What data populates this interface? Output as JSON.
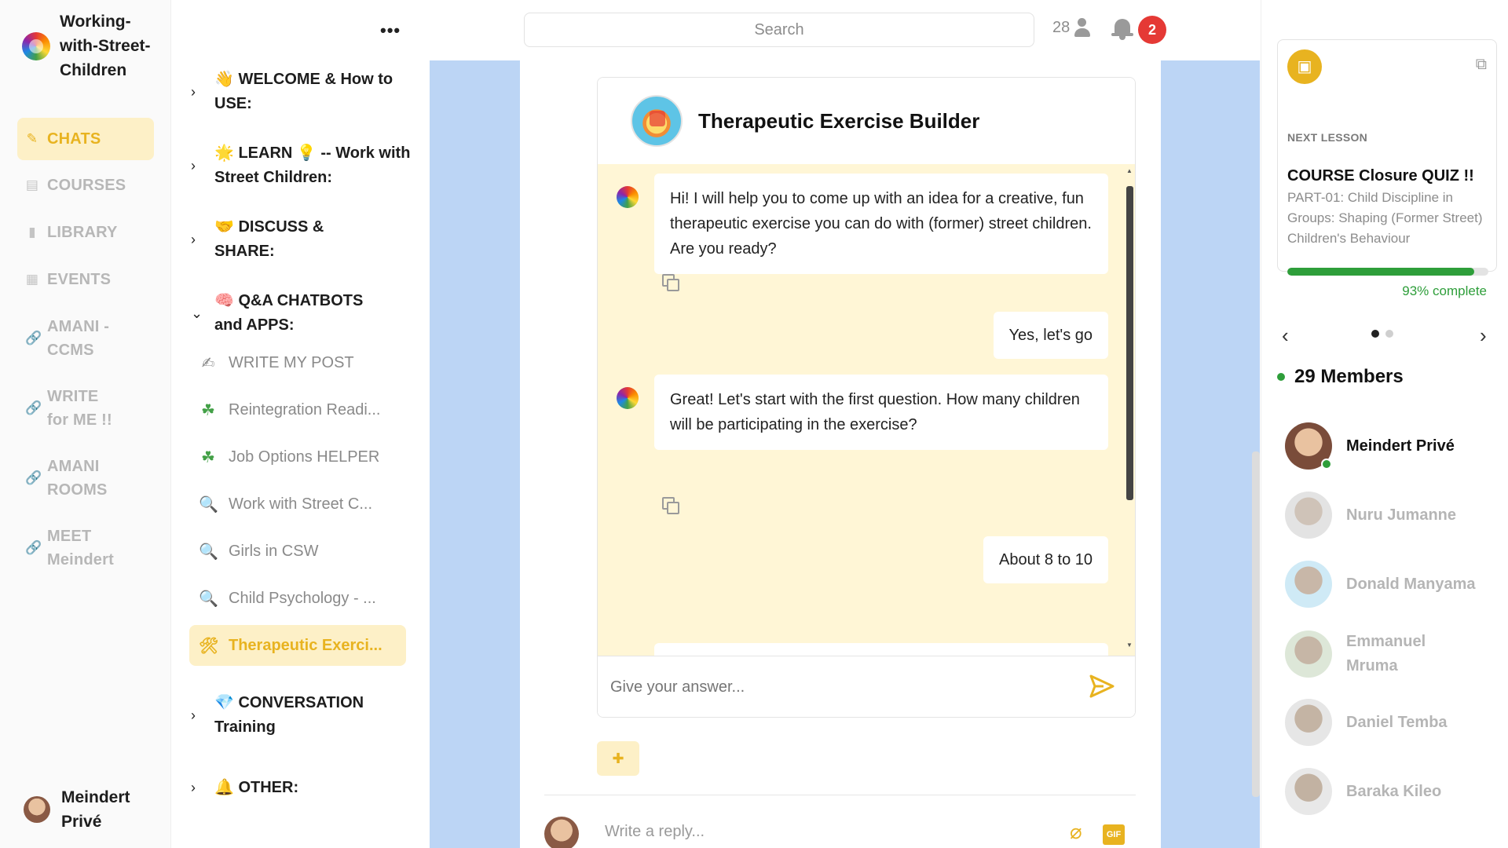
{
  "brand": {
    "name": "Working-with-Street-Children"
  },
  "nav": {
    "items": [
      {
        "label": "CHATS",
        "icon": "pencil-icon",
        "active": true
      },
      {
        "label": "COURSES",
        "icon": "book-icon"
      },
      {
        "label": "LIBRARY",
        "icon": "document-icon"
      },
      {
        "label": "EVENTS",
        "icon": "calendar-icon"
      },
      {
        "label": "AMANI - CCMS",
        "icon": "link-icon"
      },
      {
        "label": "WRITE for ME !!",
        "icon": "link-icon"
      },
      {
        "label": "AMANI ROOMS",
        "icon": "link-icon"
      },
      {
        "label": "MEET Meindert",
        "icon": "link-icon"
      }
    ],
    "user_name": "Meindert Privé"
  },
  "channels": {
    "more_label": "•••",
    "groups": [
      {
        "title": "👋 WELCOME & How to USE:",
        "expanded": false
      },
      {
        "title": "🌟 LEARN 💡 -- Work with Street Children:",
        "expanded": false
      },
      {
        "title": "🤝 DISCUSS & SHARE:",
        "expanded": false
      },
      {
        "title": "🧠 Q&A CHATBOTS and APPS:",
        "expanded": true
      },
      {
        "title": "💎 CONVERSATION Training",
        "expanded": false
      },
      {
        "title": "🔔 OTHER:",
        "expanded": false
      }
    ],
    "items": [
      {
        "label": "WRITE MY POST",
        "icon": "✍"
      },
      {
        "label": "Reintegration Readi...",
        "icon": "☘"
      },
      {
        "label": "Job Options HELPER",
        "icon": "☘"
      },
      {
        "label": "Work with Street C...",
        "icon": "🔍"
      },
      {
        "label": "Girls in CSW",
        "icon": "🔍"
      },
      {
        "label": "Child Psychology - ...",
        "icon": "🔍"
      },
      {
        "label": "Therapeutic Exerci...",
        "icon": "🛠",
        "active": true
      }
    ]
  },
  "topbar": {
    "search_placeholder": "Search",
    "online_count": "28",
    "notification_count": "2"
  },
  "chat": {
    "title": "Therapeutic Exercise Builder",
    "messages": [
      {
        "role": "bot",
        "text": "Hi! I will help you to come up with an idea for a creative, fun therapeutic exercise you can do with (former) street children. Are you ready?"
      },
      {
        "role": "user",
        "text": "Yes, let's go"
      },
      {
        "role": "bot",
        "text": "Great! Let's start with the first question. How many children will be participating in the exercise?"
      },
      {
        "role": "user",
        "text": "About 8 to 10"
      }
    ],
    "answer_placeholder": "Give your answer...",
    "reply_placeholder": "Write a reply...",
    "gif_label": "GIF"
  },
  "lesson": {
    "next_label": "NEXT LESSON",
    "title": "COURSE Closure QUIZ !!",
    "subtitle": "PART-01: Child Discipline in Groups: Shaping (Former Street) Children's Behaviour",
    "progress": 0.93,
    "progress_text": "93% complete"
  },
  "members": {
    "title": "29 Members",
    "list": [
      {
        "name": "Meindert Privé",
        "online": true
      },
      {
        "name": "Nuru Jumanne",
        "online": false
      },
      {
        "name": "Donald Manyama",
        "online": false
      },
      {
        "name": "Emmanuel Mruma",
        "online": false
      },
      {
        "name": "Daniel Temba",
        "online": false
      },
      {
        "name": "Baraka Kileo",
        "online": false
      }
    ]
  },
  "colors": {
    "accent": "#e8b320",
    "accent_bg": "#fdf0c7",
    "chat_bg": "#fff6d6",
    "center_bg": "#bcd5f5",
    "success": "#2e9e3a",
    "badge": "#e53935"
  }
}
